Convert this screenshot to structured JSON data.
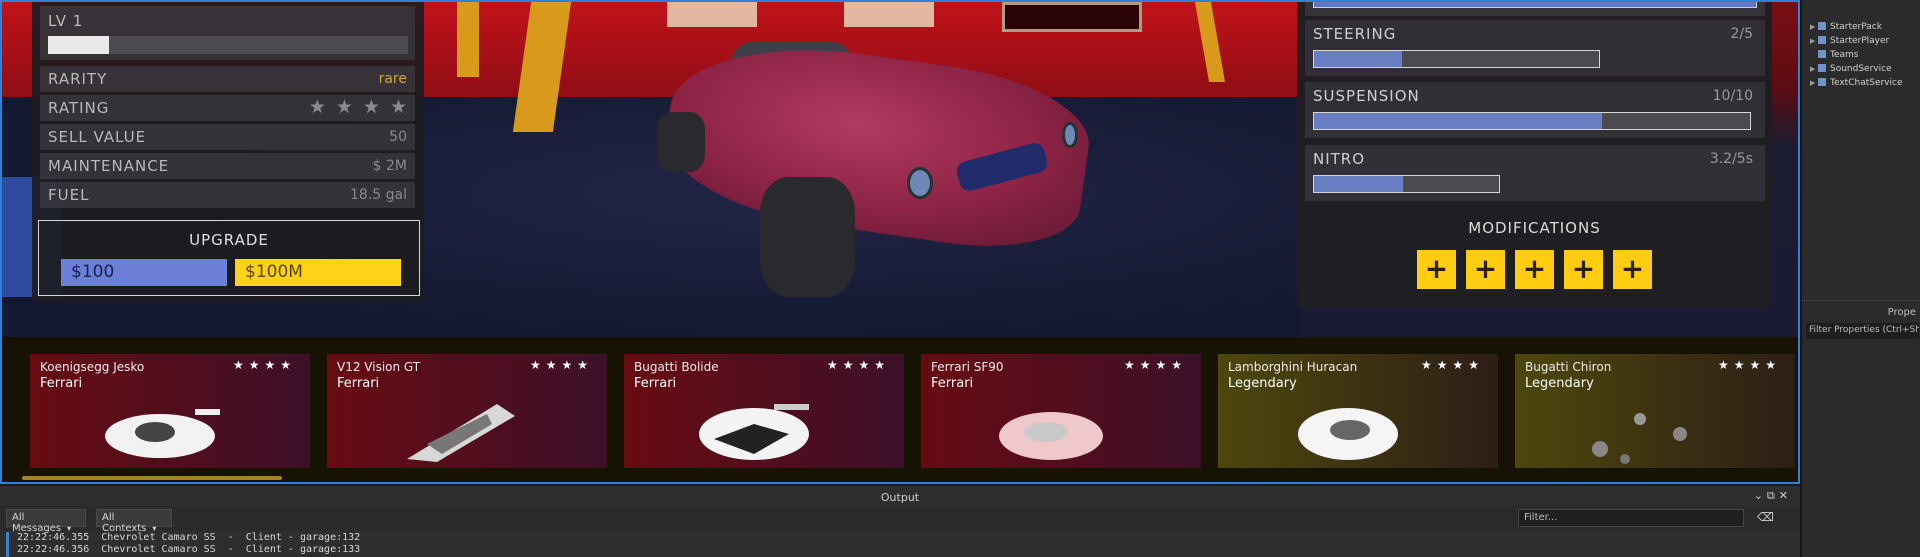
{
  "stats": {
    "level_label": "LV 1",
    "level_progress": 0.17,
    "rows": [
      {
        "label": "RARITY",
        "value": "rare"
      },
      {
        "label": "RATING",
        "stars": 4
      },
      {
        "label": "SELL VALUE",
        "value": "50"
      },
      {
        "label": "MAINTENANCE",
        "value": "$ 2M"
      },
      {
        "label": "FUEL",
        "value": "18.5 gal"
      }
    ],
    "upgrade": {
      "title": "UPGRADE",
      "blue_price": "$100",
      "yellow_price": "$100M"
    }
  },
  "upgrades_panel": {
    "top_progress": 0.97,
    "rows": [
      {
        "label": "STEERING",
        "value": "2/5",
        "progress": 0.31
      },
      {
        "label": "SUSPENSION",
        "value": "10/10",
        "progress": 0.66
      },
      {
        "label": "NITRO",
        "value": "3.2/5s",
        "progress": 0.48
      }
    ],
    "modifications_title": "MODIFICATIONS",
    "mod_buttons": [
      "+",
      "+",
      "+",
      "+",
      "+"
    ]
  },
  "cards": [
    {
      "name": "Koenigsegg Jesko",
      "sub": "Ferrari",
      "stars": "★★★★",
      "theme": "red"
    },
    {
      "name": "V12 Vision GT",
      "sub": "Ferrari",
      "stars": "★★★★",
      "theme": "red"
    },
    {
      "name": "Bugatti Bolide",
      "sub": "Ferrari",
      "stars": "★★★★",
      "theme": "red"
    },
    {
      "name": "Ferrari SF90",
      "sub": "Ferrari",
      "stars": "★★★★",
      "theme": "red"
    },
    {
      "name": "Lamborghini Huracan",
      "sub": "Legendary",
      "stars": "★★★★",
      "theme": "gold"
    },
    {
      "name": "Bugatti Chiron",
      "sub": "Legendary",
      "stars": "★★★★",
      "theme": "gold"
    }
  ],
  "explorer": {
    "items": [
      "StarterPack",
      "StarterPlayer",
      "Teams",
      "SoundService",
      "TextChatService"
    ]
  },
  "properties": {
    "title": "Prope",
    "filter_placeholder": "Filter Properties (Ctrl+Shift+"
  },
  "output": {
    "title": "Output",
    "messages_filter": "All Messages",
    "contexts_filter": "All Contexts",
    "filter_placeholder": "Filter...",
    "lines": [
      "22:22:46.355  Chevrolet Camaro SS  -  Client - garage:132",
      "22:22:46.356  Chevrolet Camaro SS  -  Client - garage:133"
    ]
  },
  "colors": {
    "accent_blue": "#6b7fd8",
    "accent_yellow": "#ffd21a",
    "rarity_gold": "#cfa43b",
    "selection_border": "#2f80d9"
  }
}
